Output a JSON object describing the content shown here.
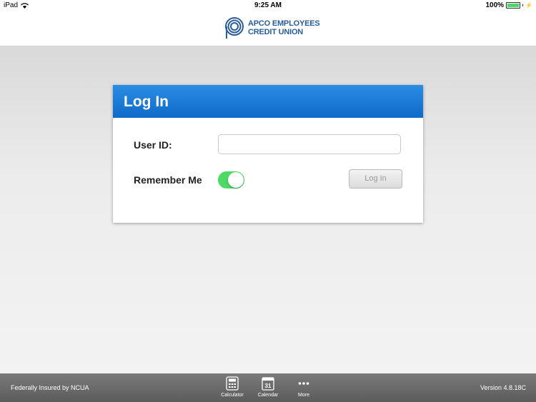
{
  "status_bar": {
    "device": "iPad",
    "time": "9:25 AM",
    "battery": "100%"
  },
  "header": {
    "logo_line1": "APCO EMPLOYEES",
    "logo_line2": "CREDIT UNION"
  },
  "login": {
    "title": "Log In",
    "user_id_label": "User ID:",
    "user_id_value": "",
    "remember_label": "Remember Me",
    "remember_on": true,
    "button_label": "Log In"
  },
  "footer": {
    "left_text": "Federally Insured by NCUA",
    "version": "Version 4.8.18C",
    "tools": [
      {
        "label": "Calculator",
        "icon": "calculator-icon"
      },
      {
        "label": "Calendar",
        "icon": "calendar-icon",
        "day": "31"
      },
      {
        "label": "More",
        "icon": "more-icon"
      }
    ]
  },
  "colors": {
    "brand_blue": "#2a5d9c",
    "header_blue": "#1578d6",
    "toggle_green": "#4cd964"
  }
}
